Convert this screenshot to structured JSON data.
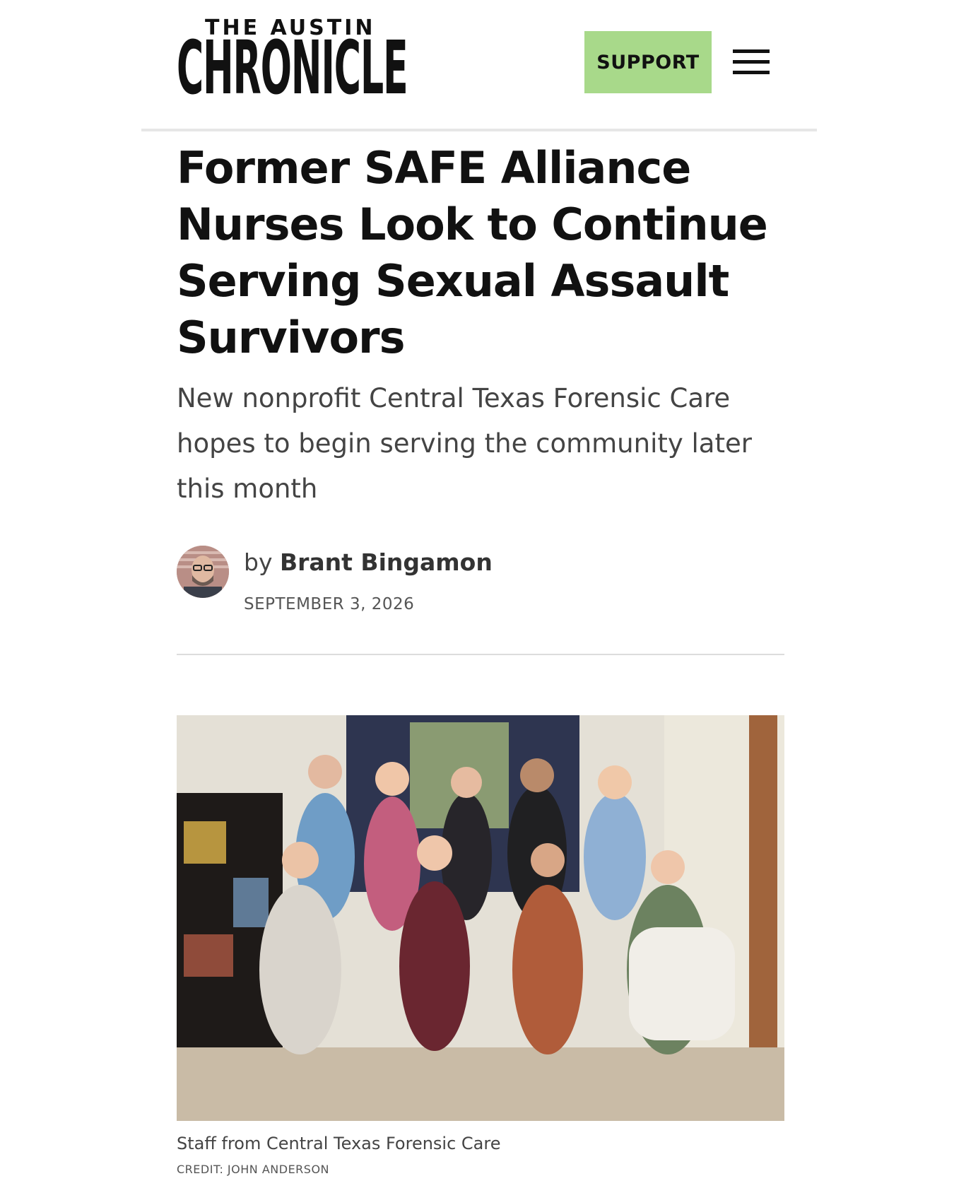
{
  "header": {
    "logo_top": "THE AUSTIN",
    "logo_main": "CHRONICLE",
    "support_label": "SUPPORT",
    "menu_icon": "hamburger-menu-icon",
    "support_color": "#a8d98a"
  },
  "article": {
    "headline": "Former SAFE Alliance Nurses Look to Continue Serving Sexual Assault Survivors",
    "dek": "New nonprofit Central Texas Forensic Care hopes to begin serving the community later this month",
    "byline_prefix": "by",
    "author": "Brant Bingamon",
    "date": "SEPTEMBER 3, 2026"
  },
  "photo": {
    "caption": "Staff from Central Texas Forensic Care",
    "credit": "CREDIT: JOHN ANDERSON"
  }
}
